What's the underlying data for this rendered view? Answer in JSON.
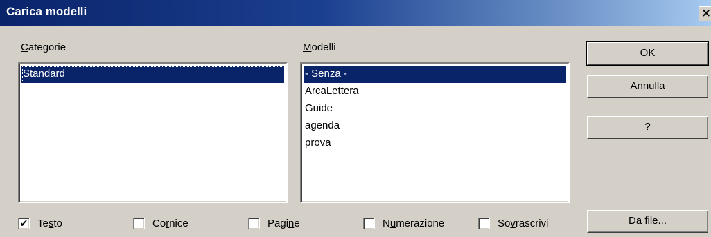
{
  "window": {
    "title": "Carica modelli",
    "close_glyph": "×"
  },
  "categories": {
    "label_pre": "",
    "label_u": "C",
    "label_post": "ategorie",
    "items": [
      {
        "label": "Standard",
        "selected": true
      }
    ]
  },
  "models": {
    "label_pre": "",
    "label_u": "M",
    "label_post": "odelli",
    "items": [
      {
        "label": "- Senza -",
        "selected": true
      },
      {
        "label": "ArcaLettera",
        "selected": false
      },
      {
        "label": "Guide",
        "selected": false
      },
      {
        "label": "agenda",
        "selected": false
      },
      {
        "label": "prova",
        "selected": false
      }
    ]
  },
  "buttons": {
    "ok": "OK",
    "cancel": "Annulla",
    "help_u": "?",
    "from_file_pre": "Da ",
    "from_file_u": "f",
    "from_file_post": "ile..."
  },
  "checkboxes": [
    {
      "pre": "Te",
      "u": "s",
      "post": "to",
      "checked": true
    },
    {
      "pre": "Co",
      "u": "r",
      "post": "nice",
      "checked": false
    },
    {
      "pre": "Pagi",
      "u": "n",
      "post": "e",
      "checked": false
    },
    {
      "pre": "N",
      "u": "u",
      "post": "merazione",
      "checked": false
    },
    {
      "pre": "So",
      "u": "v",
      "post": "rascrivi",
      "checked": false
    }
  ],
  "check_glyph": "✔"
}
